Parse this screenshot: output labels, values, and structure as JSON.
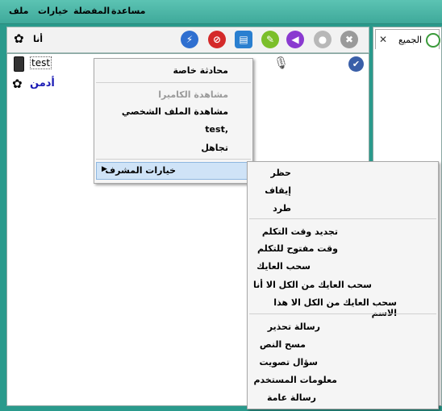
{
  "menubar": {
    "file": "ملف",
    "options": "خيارات",
    "favorites": "المفضلة",
    "help": "مساعدة"
  },
  "header": {
    "me_label": "أنا"
  },
  "users": [
    {
      "name": "test"
    },
    {
      "name": "أدمن"
    }
  ],
  "tab": {
    "label": "الجميع",
    "close": "✕"
  },
  "context_menu": {
    "items": [
      "محادثة خاصة",
      "مشاهدة الكاميرا",
      "مشاهدة الملف الشخصي",
      "test,",
      "تجاهل"
    ],
    "admin_options": "خيارات المشرف"
  },
  "admin_menu": {
    "group1": [
      "حظر",
      "إيقاف",
      "طرد"
    ],
    "group2": [
      "تجديد وقت التكلم",
      "وقت مفتوح للتكلم",
      "سحب العايك",
      "سحب العايك من الكل الا أنا",
      "سحب العايك من الكل الا هذا الاسم"
    ],
    "group3": [
      "رسالة تحذير",
      "مسح النص",
      "سؤال تصويت",
      "معلومات المستخدم",
      "رسالة عامة"
    ]
  },
  "colors": {
    "accent": "#2a9a8c",
    "admin_name": "#1b1bb5"
  }
}
